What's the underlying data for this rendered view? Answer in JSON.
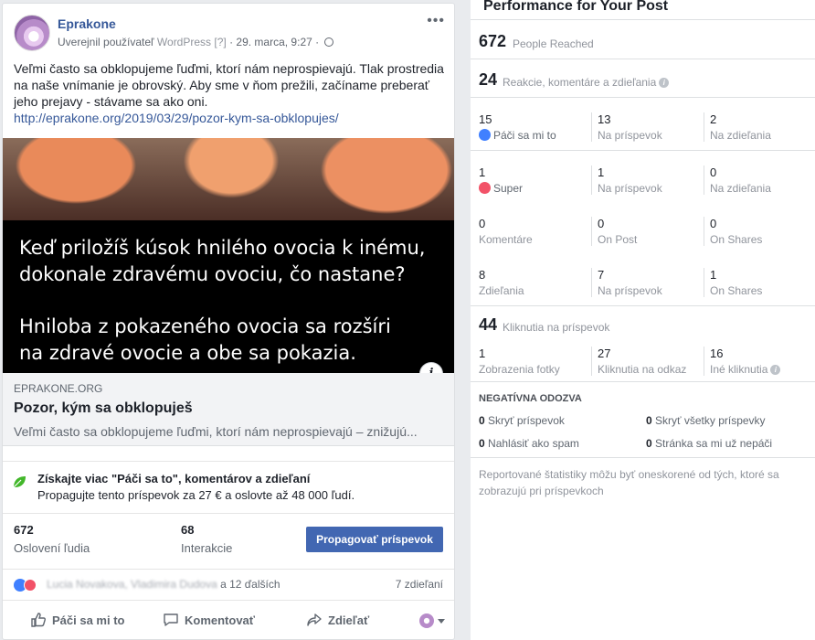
{
  "post": {
    "page_name": "Eprakone",
    "meta_prefix": "Uverejnil používateľ",
    "meta_app": "WordPress",
    "meta_help": "[?]",
    "meta_date": "· 29. marca, 9:27 ·",
    "text": "Veľmi často sa obklopujeme ľuďmi, ktorí nám neprospievajú. Tlak prostredia na naše vnímanie je obrovský. Aby sme v ňom prežili, začíname preberať jeho prejavy - stávame sa ako oni.",
    "link": "http://eprakone.org/2019/03/29/pozor-kym-sa-obklopujes/",
    "image_question_1": "Keď priložíš kúsok hnilého ovocia k inému,",
    "image_question_2": "dokonale zdravému ovociu, čo nastane?",
    "image_answer_1": "Hniloba z pokazeného ovocia sa rozšíri",
    "image_answer_2": "na zdravé ovocie a obe sa pokazia.",
    "info_glyph": "i",
    "link_domain": "EPRAKONE.ORG",
    "link_title": "Pozor, kým sa obklopuješ",
    "link_desc": "Veľmi často sa obklopujeme ľuďmi, ktorí nám neprospievajú – znižujú...",
    "promo_title": "Získajte viac \"Páči sa to\", komentárov a zdieľaní",
    "promo_sub": "Propagujte tento príspevok za 27 € a oslovte až 48 000 ľudí.",
    "reached_value": "672",
    "reached_label": "Oslovení ľudia",
    "interactions_value": "68",
    "interactions_label": "Interakcie",
    "promote_button": "Propagovať príspevok",
    "reaction_names_blurred": "Lucia Novakova, Vladimira Dudova",
    "reaction_names_suffix": "a 12 ďalších",
    "shares": "7 zdieľaní",
    "like_action": "Páči sa mi to",
    "comment_action": "Komentovať",
    "share_action": "Zdieľať"
  },
  "performance": {
    "title": "Performance for Your Post",
    "people_reached_value": "672",
    "people_reached_label": "People Reached",
    "engagement_value": "24",
    "engagement_label": "Reakcie, komentáre a zdieľania",
    "rows": [
      {
        "c1n": "15",
        "c1l": "Páči sa mi to",
        "c2n": "13",
        "c2l": "Na príspevok",
        "c3n": "2",
        "c3l": "Na zdieľania"
      },
      {
        "c1n": "1",
        "c1l": "Super",
        "c2n": "1",
        "c2l": "Na príspevok",
        "c3n": "0",
        "c3l": "Na zdieľania"
      },
      {
        "c1n": "0",
        "c1l": "Komentáre",
        "c2n": "0",
        "c2l": "On Post",
        "c3n": "0",
        "c3l": "On Shares"
      },
      {
        "c1n": "8",
        "c1l": "Zdieľania",
        "c2n": "7",
        "c2l": "Na príspevok",
        "c3n": "1",
        "c3l": "On Shares"
      }
    ],
    "clicks_value": "44",
    "clicks_label": "Kliknutia na príspevok",
    "clicks": {
      "c1n": "1",
      "c1l": "Zobrazenia fotky",
      "c2n": "27",
      "c2l": "Kliknutia na odkaz",
      "c3n": "16",
      "c3l": "Iné kliknutia"
    },
    "negative_title": "NEGATÍVNA ODOZVA",
    "negative": [
      {
        "n": "0",
        "l": "Skryť príspevok"
      },
      {
        "n": "0",
        "l": "Skryť všetky príspevky"
      },
      {
        "n": "0",
        "l": "Nahlásiť ako spam"
      },
      {
        "n": "0",
        "l": "Stránka sa mi už nepáči"
      }
    ],
    "note": "Reportované štatistiky môžu byť oneskorené od tých, ktoré sa zobrazujú pri príspevkoch"
  }
}
